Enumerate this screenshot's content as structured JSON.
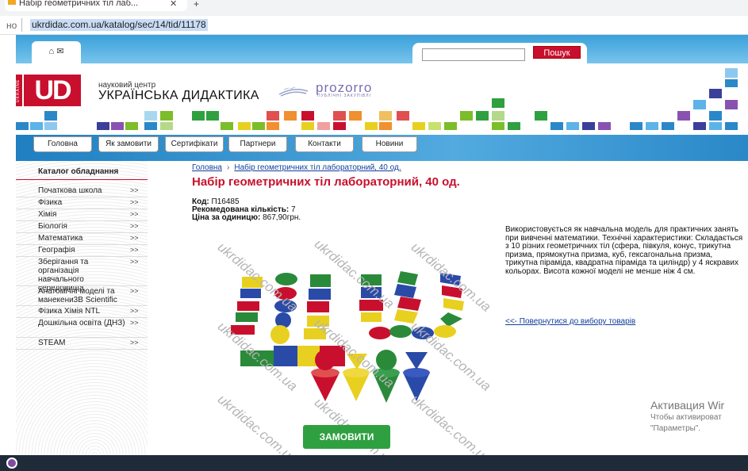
{
  "browser": {
    "tab_title": "Набір геометричних тіл лаб...",
    "url_prefix": "но",
    "url": "ukrdidac.com.ua/katalog/sec/14/tid/11178"
  },
  "header": {
    "home_icons": "⌂ ✉",
    "search_button": "Пошук",
    "logo_vertical": "UKRAINE",
    "logo_mark": "UD",
    "logo_subtitle": "науковий центр",
    "logo_title": "УКРАЇНСЬКА ДИДАКТИКА",
    "partner_name": "prozorro",
    "partner_sub": "ПУБЛІЧНІ ЗАКУПІВЛІ"
  },
  "nav": {
    "items": [
      "Головна",
      "Як замовити",
      "Сертифікати",
      "Партнери",
      "Контакти",
      "Новини"
    ]
  },
  "sidebar": {
    "title": "Каталог обладнання",
    "arrow": ">>",
    "items": [
      "Початкова школа",
      "Фізика",
      "Хімія",
      "Біологія",
      "Математика",
      "Географія",
      "Зберігання та організація навчального середовища",
      "Анатомічні моделі та манекени3B Scientific",
      "Фізика Хімія NTL",
      "Дошкільна освіта (ДНЗ)",
      "STEAM"
    ]
  },
  "breadcrumb": {
    "home": "Головна",
    "separator": "›",
    "current": "Набір геометричних тіл лабораторний, 40 од."
  },
  "product": {
    "title": "Набір геометричних тіл лабораторний, 40 од.",
    "code_label": "Код:",
    "code": "П16485",
    "qty_label": "Рекомедована кількість:",
    "qty": "7",
    "price_label": "Ціна за одиницю:",
    "price": "867,90грн.",
    "watermark": "ukrdidac.com.ua",
    "description": "Використовується як навчальна модель для практичних занять при вивченні математики. Технічні характеристики: Складається з 10 різних геометричних тіл (сфера, півкуля, конус, трикутна призма, прямокутна призма, куб, гексагональна призма, трикутна піраміда, квадратна піраміда та циліндр) у 4 яскравих кольорах. Висота кожної моделі не менше ніж 4 см.",
    "back_link": "<<- Повернутися до вибору товарів",
    "order_button": "ЗАМОВИТИ"
  },
  "os": {
    "activation_title": "Активация Wir",
    "activation_line1": "Чтобы активироват",
    "activation_line2": "\"Параметры\"."
  },
  "colors": {
    "brand_red": "#c8102e",
    "nav_blue": "#2a88c8",
    "order_green": "#2fa040",
    "link_blue": "#123f9c"
  }
}
